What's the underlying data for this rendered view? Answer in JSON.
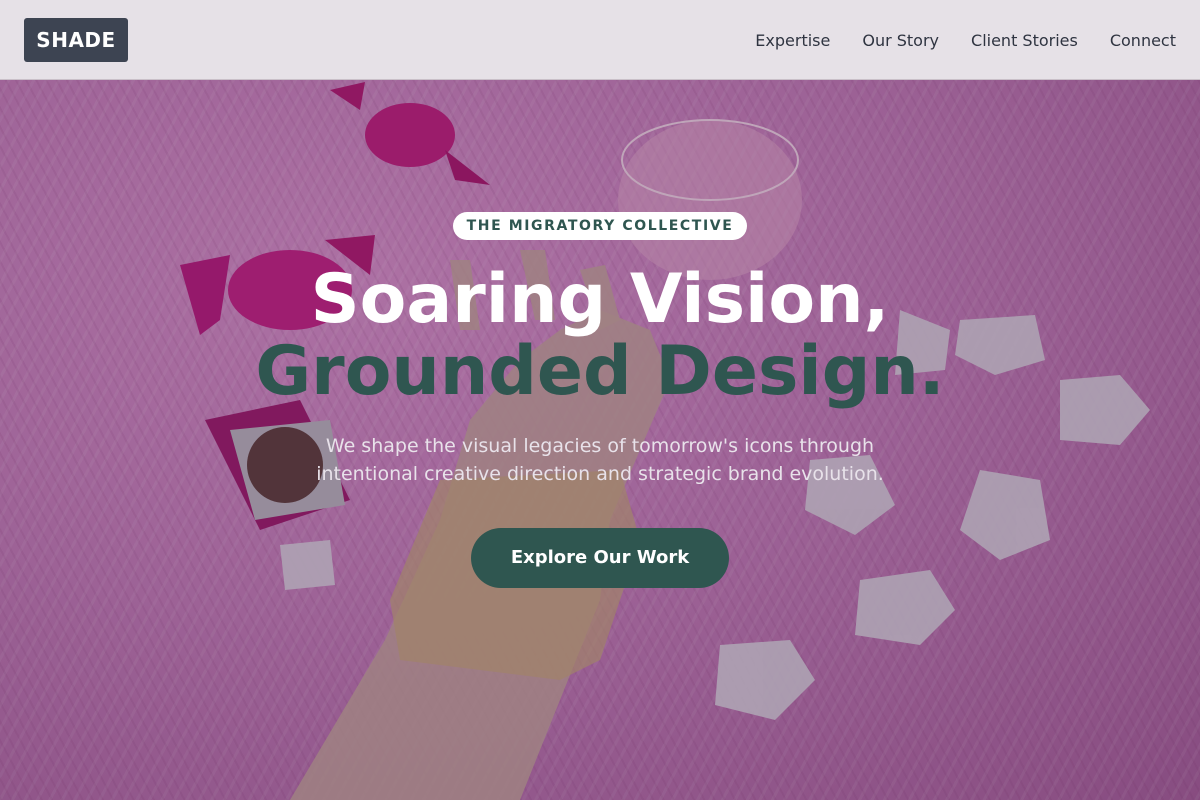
{
  "nav": {
    "logo": "SHADE",
    "links": [
      "Expertise",
      "Our Story",
      "Client Stories",
      "Connect"
    ]
  },
  "hero": {
    "eyebrow": "THE MIGRATORY COLLECTIVE",
    "headline_line1": "Soaring Vision,",
    "headline_line2": "Grounded Design.",
    "subtitle": "We shape the visual legacies of tomorrow's icons through intentional creative direction and strategic brand evolution.",
    "cta_label": "Explore Our Work"
  },
  "colors": {
    "nav_background": "#e6e1e7",
    "logo_background": "#3d4452",
    "accent_green": "#2f5650",
    "headline_white": "#ffffff",
    "hero_pink": "#c37ab7"
  },
  "icons": {
    "hero_image": "photo-hand-jewelry-candy-petals"
  }
}
